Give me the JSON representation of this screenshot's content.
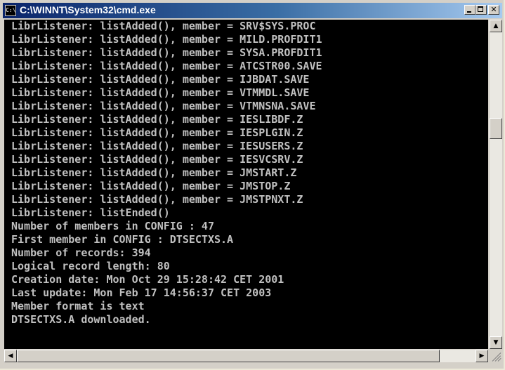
{
  "window": {
    "title": "C:\\WINNT\\System32\\cmd.exe",
    "icon_text": "C:\\"
  },
  "console": {
    "lines": [
      "LibrListener: listAdded(), member = SRV$SYS.PROC",
      "LibrListener: listAdded(), member = MILD.PROFDIT1",
      "LibrListener: listAdded(), member = SYSA.PROFDIT1",
      "LibrListener: listAdded(), member = ATCSTR00.SAVE",
      "LibrListener: listAdded(), member = IJBDAT.SAVE",
      "LibrListener: listAdded(), member = VTMMDL.SAVE",
      "LibrListener: listAdded(), member = VTMNSNA.SAVE",
      "LibrListener: listAdded(), member = IESLIBDF.Z",
      "LibrListener: listAdded(), member = IESPLGIN.Z",
      "LibrListener: listAdded(), member = IESUSERS.Z",
      "LibrListener: listAdded(), member = IESVCSRV.Z",
      "LibrListener: listAdded(), member = JMSTART.Z",
      "LibrListener: listAdded(), member = JMSTOP.Z",
      "LibrListener: listAdded(), member = JMSTPNXT.Z",
      "LibrListener: listEnded()",
      "Number of members in CONFIG : 47",
      "First member in CONFIG : DTSECTXS.A",
      "Number of records: 394",
      "Logical record length: 80",
      "Creation date: Mon Oct 29 15:28:42 CET 2001",
      "Last update: Mon Feb 17 14:56:37 CET 2003",
      "Member format is text",
      "DTSECTXS.A downloaded."
    ]
  },
  "icons": {
    "app": "cmd-icon",
    "minimize": "minimize-icon",
    "maximize": "maximize-icon",
    "close": "close-icon",
    "scroll_up": "arrow-up-icon",
    "scroll_down": "arrow-down-icon",
    "scroll_left": "arrow-left-icon",
    "scroll_right": "arrow-right-icon"
  },
  "colors": {
    "title_gradient_start": "#0a246a",
    "title_gradient_end": "#a6caf0",
    "console_bg": "#000000",
    "console_text": "#c0c0c0"
  }
}
